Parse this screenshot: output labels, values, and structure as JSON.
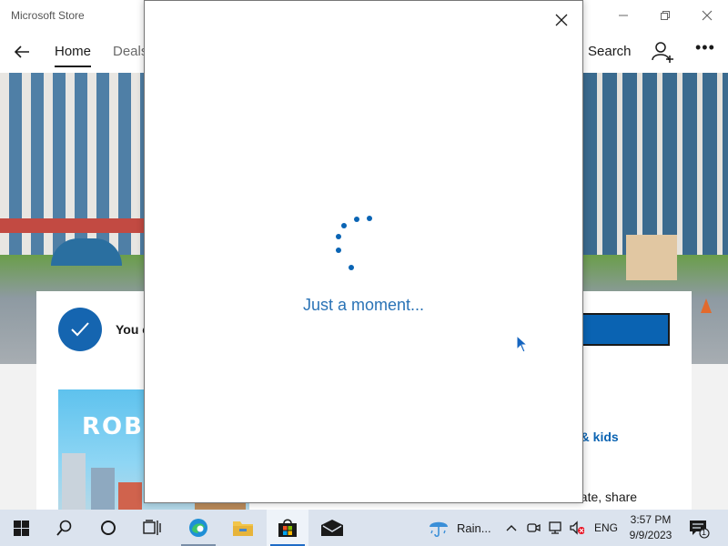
{
  "window": {
    "title": "Microsoft Store"
  },
  "nav": {
    "tabs": [
      "Home",
      "Deals"
    ],
    "search_label": "Search"
  },
  "install_banner": {
    "text": "You c"
  },
  "featured": {
    "logo_text": "ROB",
    "category": "y & kids",
    "description": "eate, share"
  },
  "dialog": {
    "loading_text": "Just a moment..."
  },
  "taskbar": {
    "weather_text": "Rain...",
    "language": "ENG",
    "time": "3:57 PM",
    "date": "9/9/2023",
    "notification_count": "1"
  },
  "colors": {
    "accent": "#0a63b2",
    "spinner": "#0a64b4",
    "loading_text": "#2a73b6",
    "taskbar_bg": "#dbe3ee"
  },
  "icons": {
    "back": "back-arrow-icon",
    "user": "add-user-icon",
    "more": "more-options-icon",
    "check": "checkmark-icon",
    "close": "close-icon",
    "start": "windows-start-icon",
    "search": "search-icon",
    "cortana": "cortana-icon",
    "task_view": "task-view-icon",
    "edge": "edge-icon",
    "explorer": "file-explorer-icon",
    "store": "store-icon",
    "mail": "mail-icon"
  }
}
